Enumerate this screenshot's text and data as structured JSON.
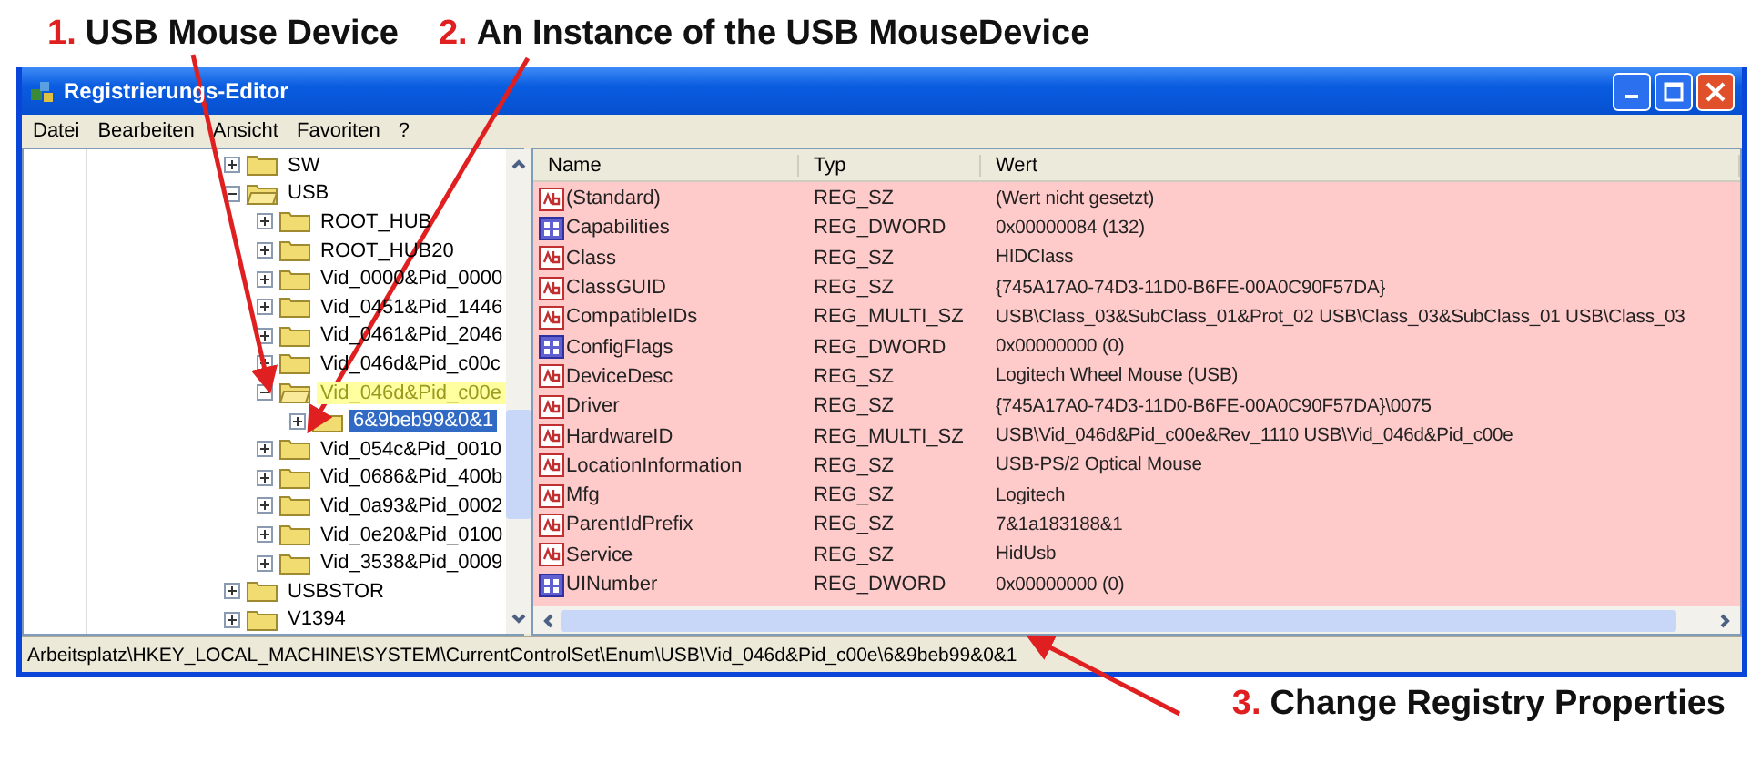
{
  "annotations": [
    {
      "number": "1.",
      "text": "USB Mouse Device"
    },
    {
      "number": "2.",
      "text": "An Instance of the USB MouseDevice"
    },
    {
      "number": "3.",
      "text": "Change Registry Properties"
    }
  ],
  "window": {
    "title": "Registrierungs-Editor"
  },
  "menu": [
    "Datei",
    "Bearbeiten",
    "Ansicht",
    "Favoriten",
    "?"
  ],
  "tree": {
    "items": [
      {
        "label": "SW",
        "expanded": false,
        "selected": false,
        "highlighted": false
      },
      {
        "label": "USB",
        "expanded": true,
        "selected": false,
        "highlighted": false,
        "children": [
          {
            "label": "ROOT_HUB",
            "expanded": false,
            "selected": false,
            "highlighted": false
          },
          {
            "label": "ROOT_HUB20",
            "expanded": false,
            "selected": false,
            "highlighted": false
          },
          {
            "label": "Vid_0000&Pid_0000",
            "expanded": false,
            "selected": false,
            "highlighted": false
          },
          {
            "label": "Vid_0451&Pid_1446",
            "expanded": false,
            "selected": false,
            "highlighted": false
          },
          {
            "label": "Vid_0461&Pid_2046",
            "expanded": false,
            "selected": false,
            "highlighted": false
          },
          {
            "label": "Vid_046d&Pid_c00c",
            "expanded": false,
            "selected": false,
            "highlighted": false
          },
          {
            "label": "Vid_046d&Pid_c00e",
            "expanded": true,
            "selected": false,
            "highlighted": true,
            "children": [
              {
                "label": "6&9beb99&0&1",
                "expanded": false,
                "selected": true,
                "highlighted": false
              }
            ]
          },
          {
            "label": "Vid_054c&Pid_0010",
            "expanded": false,
            "selected": false,
            "highlighted": false
          },
          {
            "label": "Vid_0686&Pid_400b",
            "expanded": false,
            "selected": false,
            "highlighted": false
          },
          {
            "label": "Vid_0a93&Pid_0002",
            "expanded": false,
            "selected": false,
            "highlighted": false
          },
          {
            "label": "Vid_0e20&Pid_0100",
            "expanded": false,
            "selected": false,
            "highlighted": false
          },
          {
            "label": "Vid_3538&Pid_0009",
            "expanded": false,
            "selected": false,
            "highlighted": false
          }
        ]
      },
      {
        "label": "USBSTOR",
        "expanded": false,
        "selected": false,
        "highlighted": false
      },
      {
        "label": "V1394",
        "expanded": false,
        "selected": false,
        "highlighted": false
      }
    ]
  },
  "values": {
    "columns": [
      "Name",
      "Typ",
      "Wert"
    ],
    "rows": [
      {
        "kind": "string",
        "name": "(Standard)",
        "type": "REG_SZ",
        "value": "(Wert nicht gesetzt)"
      },
      {
        "kind": "binary",
        "name": "Capabilities",
        "type": "REG_DWORD",
        "value": "0x00000084 (132)"
      },
      {
        "kind": "string",
        "name": "Class",
        "type": "REG_SZ",
        "value": "HIDClass"
      },
      {
        "kind": "string",
        "name": "ClassGUID",
        "type": "REG_SZ",
        "value": "{745A17A0-74D3-11D0-B6FE-00A0C90F57DA}"
      },
      {
        "kind": "string",
        "name": "CompatibleIDs",
        "type": "REG_MULTI_SZ",
        "value": "USB\\Class_03&SubClass_01&Prot_02 USB\\Class_03&SubClass_01 USB\\Class_03"
      },
      {
        "kind": "binary",
        "name": "ConfigFlags",
        "type": "REG_DWORD",
        "value": "0x00000000 (0)"
      },
      {
        "kind": "string",
        "name": "DeviceDesc",
        "type": "REG_SZ",
        "value": "Logitech Wheel Mouse (USB)"
      },
      {
        "kind": "string",
        "name": "Driver",
        "type": "REG_SZ",
        "value": "{745A17A0-74D3-11D0-B6FE-00A0C90F57DA}\\0075"
      },
      {
        "kind": "string",
        "name": "HardwareID",
        "type": "REG_MULTI_SZ",
        "value": "USB\\Vid_046d&Pid_c00e&Rev_1110 USB\\Vid_046d&Pid_c00e"
      },
      {
        "kind": "string",
        "name": "LocationInformation",
        "type": "REG_SZ",
        "value": "USB-PS/2 Optical Mouse"
      },
      {
        "kind": "string",
        "name": "Mfg",
        "type": "REG_SZ",
        "value": "Logitech"
      },
      {
        "kind": "string",
        "name": "ParentIdPrefix",
        "type": "REG_SZ",
        "value": "7&1a183188&1"
      },
      {
        "kind": "string",
        "name": "Service",
        "type": "REG_SZ",
        "value": "HidUsb"
      },
      {
        "kind": "binary",
        "name": "UINumber",
        "type": "REG_DWORD",
        "value": "0x00000000 (0)"
      }
    ]
  },
  "status_bar": "Arbeitsplatz\\HKEY_LOCAL_MACHINE\\SYSTEM\\CurrentControlSet\\Enum\\USB\\Vid_046d&Pid_c00e\\6&9beb99&0&1"
}
